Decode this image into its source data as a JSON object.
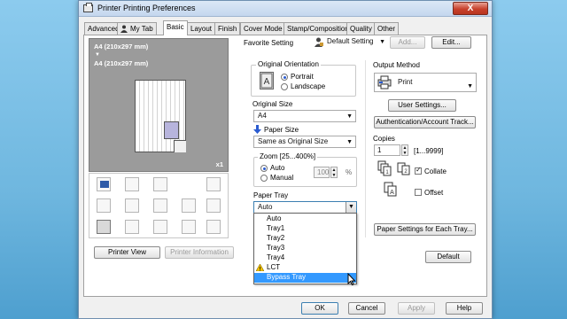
{
  "window": {
    "title": "Printer Printing Preferences",
    "close_glyph": "X"
  },
  "tabs": [
    "Advanced",
    "My Tab",
    "Basic",
    "Layout",
    "Finish",
    "Cover Mode",
    "Stamp/Composition",
    "Quality",
    "Other"
  ],
  "active_tab": "Basic",
  "favorite": {
    "label": "Favorite Setting",
    "value": "Default Setting",
    "add_label": "Add...",
    "edit_label": "Edit..."
  },
  "preview": {
    "line1": "A4 (210x297 mm)",
    "arrow": "▼",
    "line2": "A4 (210x297 mm)",
    "copies_badge": "x1",
    "printer_view_label": "Printer View",
    "printer_info_label": "Printer Information"
  },
  "orientation": {
    "title": "Original Orientation",
    "options": [
      "Portrait",
      "Landscape"
    ],
    "selected": "Portrait"
  },
  "original_size": {
    "label": "Original Size",
    "value": "A4"
  },
  "paper_size": {
    "label": "Paper Size",
    "value": "Same as Original Size"
  },
  "zoom": {
    "label": "Zoom [25...400%]",
    "options": [
      "Auto",
      "Manual"
    ],
    "selected": "Auto",
    "value": "100",
    "unit": "%"
  },
  "paper_tray": {
    "label": "Paper Tray",
    "value": "Auto",
    "options": [
      "Auto",
      "Tray1",
      "Tray2",
      "Tray3",
      "Tray4",
      "LCT",
      "Bypass Tray"
    ],
    "highlighted": "Bypass Tray",
    "warning_item": "LCT"
  },
  "output": {
    "label": "Output Method",
    "value": "Print",
    "user_settings_label": "User Settings...",
    "auth_label": "Authentication/Account Track..."
  },
  "copies": {
    "label": "Copies",
    "value": "1",
    "range": "[1...9999]",
    "collate_label": "Collate",
    "collate_checked": true,
    "offset_label": "Offset",
    "offset_checked": false
  },
  "paper_settings_label": "Paper Settings for Each Tray...",
  "default_label": "Default",
  "dialog_buttons": {
    "ok": "OK",
    "cancel": "Cancel",
    "apply": "Apply",
    "help": "Help"
  },
  "colors": {
    "highlight": "#3399ff",
    "accent_blue": "#2a5bd0",
    "close_red": "#c7412c"
  }
}
